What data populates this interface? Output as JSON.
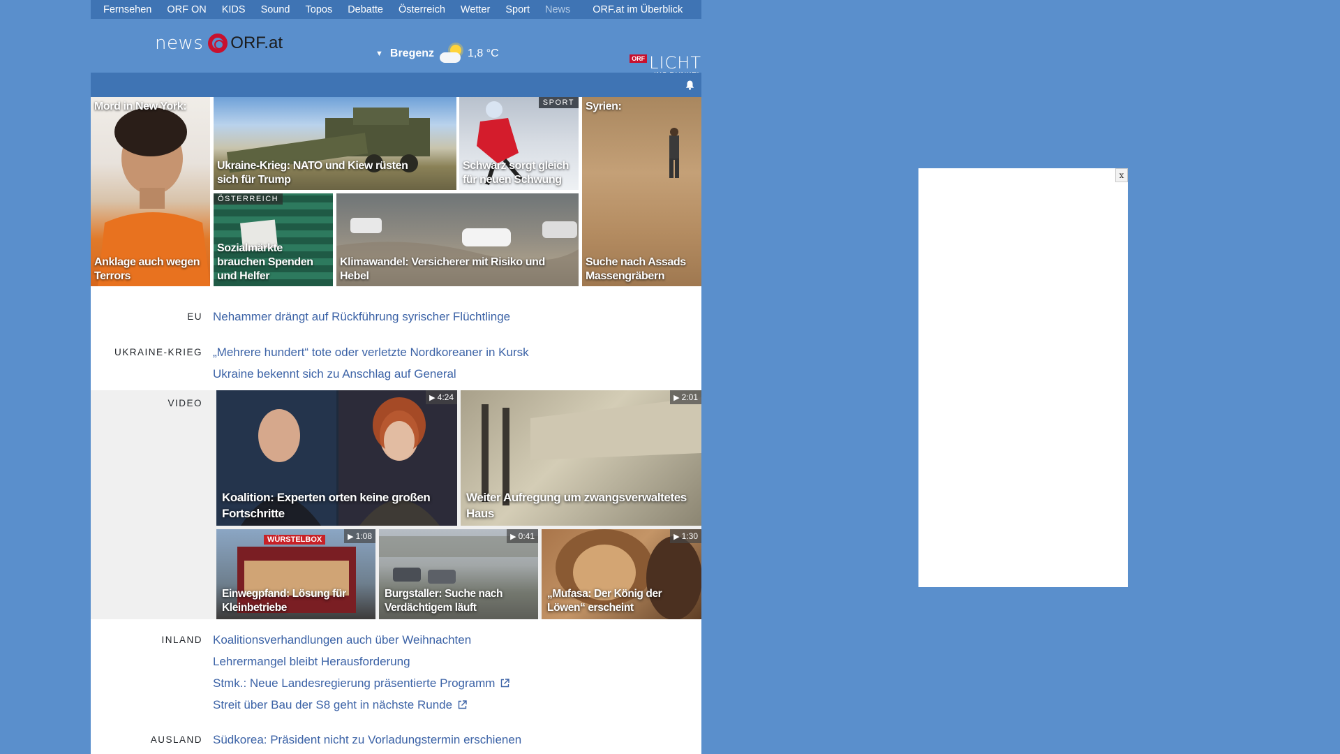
{
  "topnav": [
    "Fernsehen",
    "ORF ON",
    "KIDS",
    "Sound",
    "Topos",
    "Debatte",
    "Österreich",
    "Wetter",
    "Sport",
    "News",
    "ORF.at im Überblick"
  ],
  "header": {
    "logo_news": "news",
    "logo_orf": "ORF",
    "logo_at": ".at",
    "weather_city": "Bregenz",
    "weather_temp": "1,8 °C",
    "licht_badge": "ORF",
    "licht_big": "LICHT",
    "licht_small": "INS DUNKEL"
  },
  "teasers": {
    "t1_top": "Mord in New York:",
    "t1_cap": "Anklage auch wegen Terrors",
    "t2_cap": "Ukraine-Krieg: NATO und Kiew rüsten sich für Trump",
    "t3_tag": "SPORT",
    "t3_cap": "Schwarz sorgt gleich für neuen Schwung",
    "t4_top": "Syrien:",
    "t4_cap": "Suche nach Assads Massengräbern",
    "t5_tag": "ÖSTERREICH",
    "t5_cap": "Sozialmärkte brauchen Spenden und Helfer",
    "t6_cap": "Klimawandel: Versicherer mit Risiko und Hebel"
  },
  "sections": {
    "eu_label": "EU",
    "eu_items": [
      "Nehammer drängt auf Rückführung syrischer Flüchtlinge"
    ],
    "ukraine_label": "UKRAINE-KRIEG",
    "ukraine_items": [
      "„Mehrere hundert“ tote oder verletzte Nordkoreaner in Kursk",
      "Ukraine bekennt sich zu Anschlag auf General"
    ],
    "inland_label": "INLAND",
    "inland_items": [
      "Koalitionsverhandlungen auch über Weihnachten",
      "Lehrermangel bleibt Herausforderung",
      "Stmk.: Neue Landesregierung präsentierte Programm",
      "Streit über Bau der S8 geht in nächste Runde"
    ],
    "ausland_label": "AUSLAND",
    "ausland_items": [
      "Südkorea: Präsident nicht zu Vorladungstermin erschienen"
    ]
  },
  "video": {
    "label": "VIDEO",
    "v1_dur": "4:24",
    "v1_cap": "Koalition: Experten orten keine großen Fortschritte",
    "v2_dur": "2:01",
    "v2_cap": "Weiter Aufregung um zwangsverwaltetes Haus",
    "v3_dur": "1:08",
    "v3_cap": "Einwegpfand: Lösung für Kleinbetriebe",
    "v3_sign": "WÜRSTELBOX",
    "v4_dur": "0:41",
    "v4_cap": "Burgstaller: Suche nach Verdächtigem läuft",
    "v5_dur": "1:30",
    "v5_cap": "„Mufasa: Der König der Löwen“ erscheint"
  },
  "ad": {
    "close": "x"
  }
}
